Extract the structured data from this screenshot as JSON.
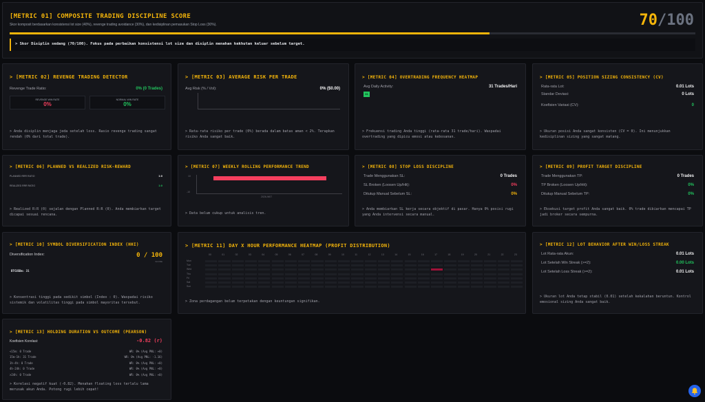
{
  "m01": {
    "title": "[METRIC 01] COMPOSITE TRADING DISCIPLINE SCORE",
    "desc": "Skor komposit berdasarkan konsistensi lot size (40%), revenge trading avoidance (30%), dan kedisiplinan pemasukan Stop Loss (30%).",
    "score": "70",
    "max": "/100",
    "progress": 0.7,
    "message": "> Skor Disiplin sedang (70/100). Fokus pada perbaikan konsistensi lot size dan disiplin menahan kekhutan keluar sebelum target."
  },
  "m02": {
    "title": "> [METRIC 02] REVENGE TRADING DETECTOR",
    "ratio_label": "Revenge Trade Ratio:",
    "ratio_value": "0% (0 Trades)",
    "box1_label": "REVENGE WIN RATE",
    "box1_value": "0%",
    "box2_label": "NORMAL WIN RATE",
    "box2_value": "0%",
    "note": "> Anda disiplin menjaga jeda setelah loss. Rasio revenge trading sangat rendah (0% dari total trade)."
  },
  "m03": {
    "title": "> [METRIC 03] AVERAGE RISK PER TRADE",
    "label": "Avg Risk (% / Vol):",
    "value": "0% ($0.00)",
    "note": "> Rata-rata risiko per trade (0%) berada dalam batas aman < 2%. Terapkan risiko Anda sangat baik."
  },
  "m04": {
    "title": "> [METRIC 04] OVERTRADING FREQUENCY HEATMAP",
    "label": "Avg Daily Activity:",
    "value": "31 Trades/Hari",
    "cell": "31",
    "note": "> Frekuensi trading Anda tinggi (rata-rata 31 trade/hari). Waspadai overtrading yang dipicu emosi atau kebosanan."
  },
  "m05": {
    "title": "> [METRIC 05] POSITION SIZING CONSISTENCY (CV)",
    "rows": [
      {
        "label": "Rata-rata Lot:",
        "value": "0.01 Lots"
      },
      {
        "label": "Standar Deviasi:",
        "value": "0 Lots"
      },
      {
        "label": "Koefisien Variasi (CV):",
        "value": "0"
      }
    ],
    "note": "> Ukuran posisi Anda sangat konsisten (CV = 0). Ini menunjukkan kedisiplinan sizing yang sangat matang."
  },
  "m06": {
    "title": "> [METRIC 06] PLANNED VS REALIZED RISK-REWARD",
    "rows": [
      {
        "label": "PLANNED RRR RATIO",
        "value": "1:0"
      },
      {
        "label": "REALIZED RRR RATIO",
        "value": "1:0"
      }
    ],
    "note": "> Realized R:R (0) sejalan dengan Planned R:R (0). Anda membiarkan target dicapai sesuai rencana."
  },
  "m07": {
    "title": "> [METRIC 07] WEEKLY ROLLING PERFORMANCE TREND",
    "y_top": "10",
    "y_bottom": "-10",
    "x_label": "2026-W07",
    "note": "> Data belum cukup untuk analisis tren."
  },
  "m08": {
    "title": "> [METRIC 08] STOP LOSS DISCIPLINE",
    "rows": [
      {
        "label": "Trade Menggunakan SL:",
        "value": "0 Trades"
      },
      {
        "label": "SL Broken (Loosen Up/Hit):",
        "value": "0%"
      },
      {
        "label": "Ditutup Manual Sebelum SL:",
        "value": "0%"
      }
    ],
    "note": "> Anda membiarkan SL kerja secara objektif di pasar. Hanya 0% posisi rugi yang Anda intervensi secara manual."
  },
  "m09": {
    "title": "> [METRIC 09] PROFIT TARGET DISCIPLINE",
    "rows": [
      {
        "label": "Trade Menggunakan TP:",
        "value": "0 Trades"
      },
      {
        "label": "TP Broken (Loosen Up/Hit):",
        "value": "0%"
      },
      {
        "label": "Ditutup Manual Sebelum TP:",
        "value": "0%"
      }
    ],
    "note": "> Eksekusi target profit Anda sangat baik. 0% trade dibiarkan mencapai TP jadi broker secara sempurna."
  },
  "m10": {
    "title": "> [METRIC 10] SYMBOL DIVERSIFICATION INDEX (HHI)",
    "label": "Diversification Index:",
    "value": "0 / 100",
    "sub": "SCORE",
    "symbol": "BTCUSDm: 31",
    "note": "> Konsentrasi tinggi pada sedikit simbol (Index : 0). Waspadai risiko sistemik dan volatilitas tinggi pada simbol mayoritas tersebut."
  },
  "m11": {
    "title": "> [METRIC 11] DAY X HOUR PERFORMANCE HEATMAP (PROFIT DISTRIBUTION)",
    "hours": [
      "00",
      "01",
      "02",
      "03",
      "04",
      "05",
      "06",
      "07",
      "08",
      "09",
      "10",
      "11",
      "12",
      "13",
      "14",
      "15",
      "16",
      "17",
      "18",
      "19",
      "20",
      "21",
      "22",
      "23"
    ],
    "days": [
      "Mon",
      "Tue",
      "Wed",
      "Thu",
      "Fri",
      "Sat",
      "Sun"
    ],
    "note": "> Zona perdagangan belum terpetakan dengan keuntungan signifikan."
  },
  "m12": {
    "title": "> [METRIC 12] LOT BEHAVIOR AFTER WIN/LOSS STREAK",
    "rows": [
      {
        "label": "Lot Rata-rata Akun:",
        "value": "0.01 Lots",
        "tone": ""
      },
      {
        "label": "Lot Setelah Win Streak (>=2):",
        "value": "0.00 Lots",
        "tone": "green"
      },
      {
        "label": "Lot Setelah Loss Streak (>=2):",
        "value": "0.01 Lots",
        "tone": ""
      }
    ],
    "note": "> Ukuran lot Anda tetap stabil (0.01) setelah kekalahan beruntun. Kontrol emosional sizing Anda sangat baik."
  },
  "m13": {
    "title": "> [METRIC 13] HOLDING DURATION VS OUTCOME (PEARSON)",
    "label": "Koefisien Korelasi:",
    "value": "-0.82 (r)",
    "rows": [
      {
        "label": "<15m: 0 Trade",
        "value": "WR: 0% (Avg PNL: +0)"
      },
      {
        "label": "15m-1h: 31 Trade",
        "value": "WR: 0% (Avg PNL: -1.16)"
      },
      {
        "label": "1h-4h: 0 Trade",
        "value": "WR: 0% (Avg PNL: +0)"
      },
      {
        "label": "4h-24h: 0 Trade",
        "value": "WR: 0% (Avg PNL: +0)"
      },
      {
        "label": ">24h: 0 Trade",
        "value": "WR: 0% (Avg PNL: +0)"
      }
    ],
    "note": "> Korelasi negatif kuat (-0.82). Menahan floating loss terlalu lama merusak akun Anda. Potong rugi lebih cepat!"
  },
  "colors": {
    "accent": "#f5b50a",
    "green": "#22c55e",
    "red": "#f43f5e",
    "bar": "#f43f5e"
  },
  "fab_icon": "bell-icon"
}
